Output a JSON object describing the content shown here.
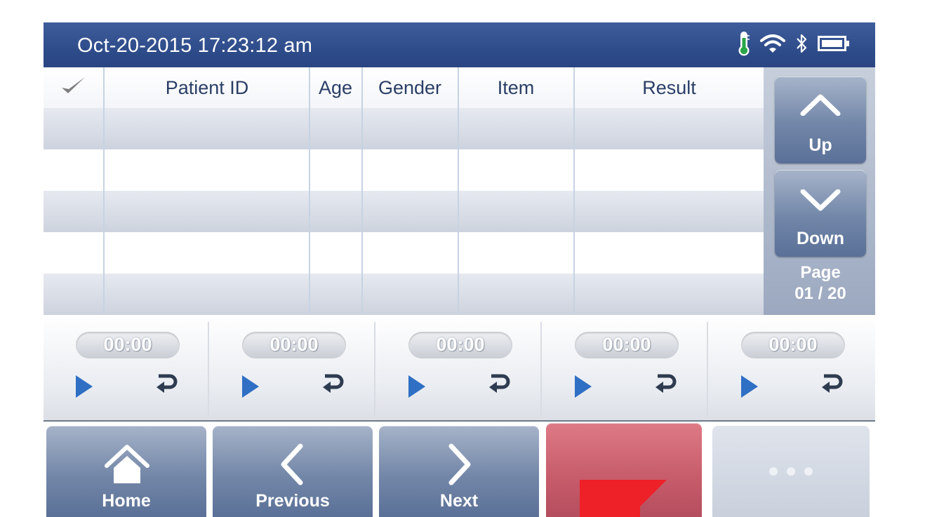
{
  "status": {
    "datetime": "Oct-20-2015  17:23:12 am",
    "icons": [
      "thermometer-icon",
      "wifi-icon",
      "bluetooth-icon",
      "battery-icon"
    ]
  },
  "table": {
    "columns": [
      "Patient ID",
      "Age",
      "Gender",
      "Item",
      "Result"
    ],
    "select_icon": "checkmark-icon",
    "rows": [
      [],
      [],
      [],
      [],
      []
    ]
  },
  "pager": {
    "up_label": "Up",
    "down_label": "Down",
    "page_label": "Page",
    "page_value": "01 / 20"
  },
  "timers": [
    {
      "time": "00:00"
    },
    {
      "time": "00:00"
    },
    {
      "time": "00:00"
    },
    {
      "time": "00:00"
    },
    {
      "time": "00:00"
    }
  ],
  "nav": {
    "home_label": "Home",
    "previous_label": "Previous",
    "next_label": "Next"
  },
  "colors": {
    "statusbar": "#2d4a88",
    "button": "#7387a8",
    "alert": "#c65b6a",
    "flag": "#ee2028"
  }
}
